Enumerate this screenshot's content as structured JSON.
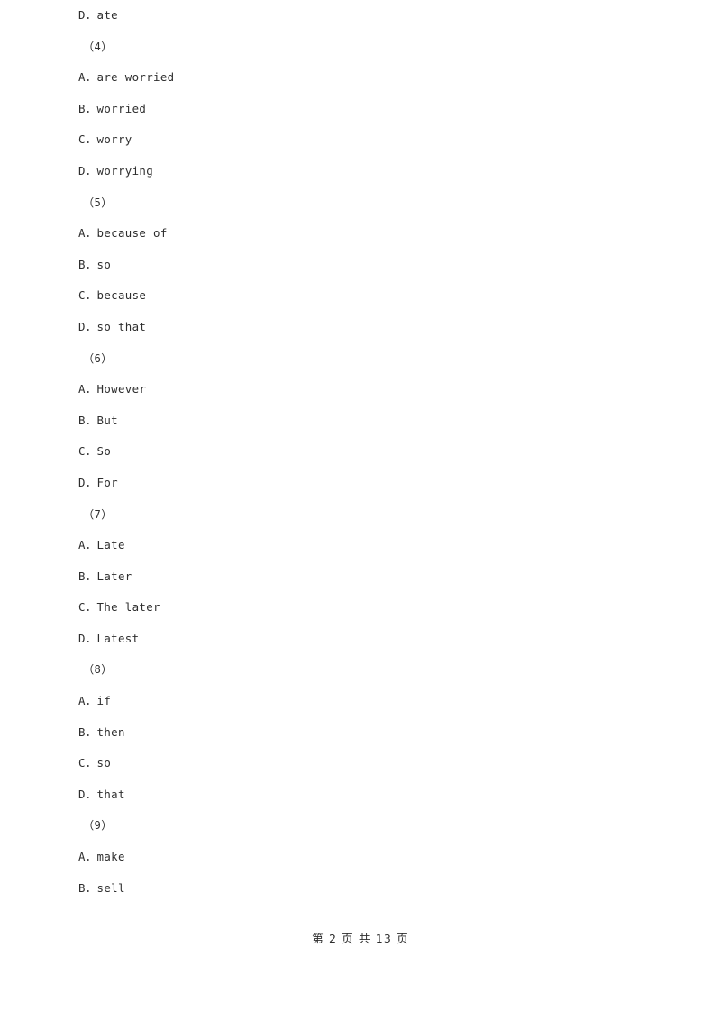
{
  "document": {
    "type": "exam-worksheet",
    "language": "zh-CN",
    "background_color": "#ffffff",
    "text_color": "#2e2e2e"
  },
  "body_lines": [
    {
      "kind": "option",
      "text": "D．ate"
    },
    {
      "kind": "qnum",
      "text": "（4）"
    },
    {
      "kind": "option",
      "text": "A．are worried"
    },
    {
      "kind": "option",
      "text": "B．worried"
    },
    {
      "kind": "option",
      "text": "C．worry"
    },
    {
      "kind": "option",
      "text": "D．worrying"
    },
    {
      "kind": "qnum",
      "text": "（5）"
    },
    {
      "kind": "option",
      "text": "A．because of"
    },
    {
      "kind": "option",
      "text": "B．so"
    },
    {
      "kind": "option",
      "text": "C．because"
    },
    {
      "kind": "option",
      "text": "D．so that"
    },
    {
      "kind": "qnum",
      "text": "（6）"
    },
    {
      "kind": "option",
      "text": "A．However"
    },
    {
      "kind": "option",
      "text": "B．But"
    },
    {
      "kind": "option",
      "text": "C．So"
    },
    {
      "kind": "option",
      "text": "D．For"
    },
    {
      "kind": "qnum",
      "text": "（7）"
    },
    {
      "kind": "option",
      "text": "A．Late"
    },
    {
      "kind": "option",
      "text": "B．Later"
    },
    {
      "kind": "option",
      "text": "C．The later"
    },
    {
      "kind": "option",
      "text": "D．Latest"
    },
    {
      "kind": "qnum",
      "text": "（8）"
    },
    {
      "kind": "option",
      "text": "A．if"
    },
    {
      "kind": "option",
      "text": "B．then"
    },
    {
      "kind": "option",
      "text": "C．so"
    },
    {
      "kind": "option",
      "text": "D．that"
    },
    {
      "kind": "qnum",
      "text": "（9）"
    },
    {
      "kind": "option",
      "text": "A．make"
    },
    {
      "kind": "option",
      "text": "B．sell"
    }
  ],
  "footer": {
    "text": "第 2 页 共 13 页",
    "current_page": "2",
    "total_pages": "13"
  }
}
